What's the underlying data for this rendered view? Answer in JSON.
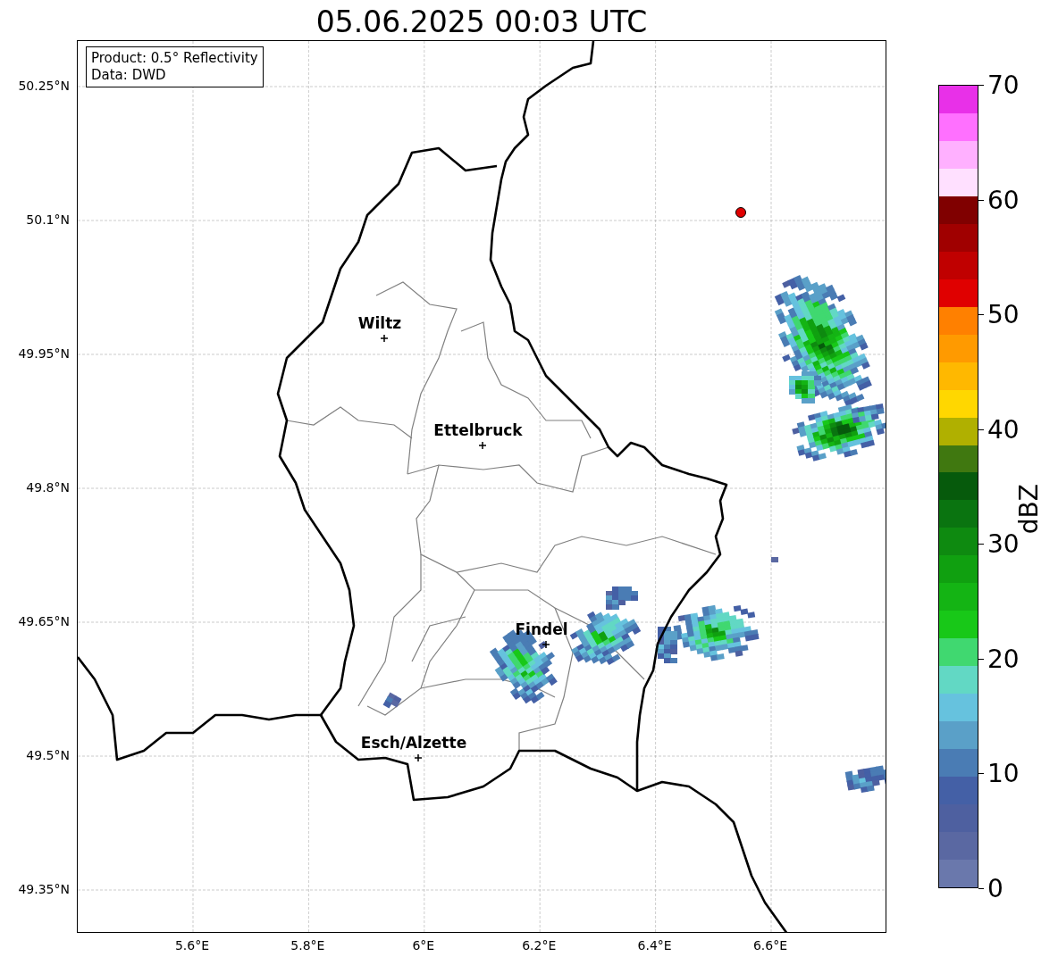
{
  "title": "05.06.2025 00:03 UTC",
  "map": {
    "info_box": [
      "Product: 0.5° Reflectivity",
      "Data: DWD"
    ],
    "lat_labels": [
      "50.25°N",
      "50.1°N",
      "49.95°N",
      "49.8°N",
      "49.65°N",
      "49.5°N",
      "49.35°N"
    ],
    "lon_labels": [
      "5.6°E",
      "5.8°E",
      "6°E",
      "6.2°E",
      "6.4°E",
      "6.6°E"
    ],
    "cities": [
      {
        "name": "Wiltz"
      },
      {
        "name": "Ettelbruck"
      },
      {
        "name": "Findel"
      },
      {
        "name": "Esch/Alzette"
      }
    ]
  },
  "colorbar": {
    "label": "dBZ",
    "ticks": [
      "70",
      "60",
      "50",
      "40",
      "30",
      "20",
      "10",
      "0"
    ],
    "bins": [
      {
        "color": "#6a78ac"
      },
      {
        "color": "#5a68a2"
      },
      {
        "color": "#4e60a0"
      },
      {
        "color": "#4460a6"
      },
      {
        "color": "#4a7cb4"
      },
      {
        "color": "#5aa0c8"
      },
      {
        "color": "#66c2de"
      },
      {
        "color": "#62d8c4"
      },
      {
        "color": "#40d870"
      },
      {
        "color": "#18c818"
      },
      {
        "color": "#14b414"
      },
      {
        "color": "#10a010"
      },
      {
        "color": "#0e8a10"
      },
      {
        "color": "#0a7410"
      },
      {
        "color": "#065a0c"
      },
      {
        "color": "#407810"
      },
      {
        "color": "#b0b000"
      },
      {
        "color": "#ffd700"
      },
      {
        "color": "#ffb800"
      },
      {
        "color": "#ff9a00"
      },
      {
        "color": "#ff8000"
      },
      {
        "color": "#e00000"
      },
      {
        "color": "#c00000"
      },
      {
        "color": "#a00000"
      },
      {
        "color": "#800000"
      },
      {
        "color": "#ffe0ff"
      },
      {
        "color": "#ffb0ff"
      },
      {
        "color": "#ff70ff"
      },
      {
        "color": "#e830e8"
      }
    ]
  }
}
